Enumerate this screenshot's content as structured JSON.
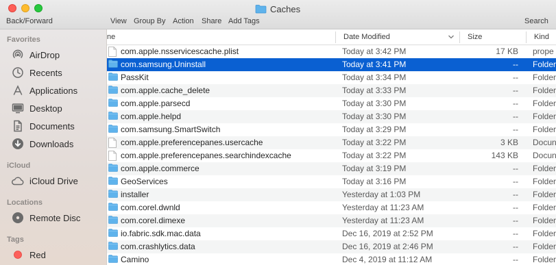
{
  "window": {
    "title": "Caches",
    "traffic": [
      "close",
      "minimize",
      "zoom"
    ]
  },
  "toolbar": {
    "back_forward": "Back/Forward",
    "view": "View",
    "group_by": "Group By",
    "action": "Action",
    "share": "Share",
    "add_tags": "Add Tags",
    "search": "Search"
  },
  "sidebar": {
    "favorites_label": "Favorites",
    "favorites": [
      {
        "label": "AirDrop",
        "icon": "airdrop-icon"
      },
      {
        "label": "Recents",
        "icon": "clock-icon"
      },
      {
        "label": "Applications",
        "icon": "applications-icon"
      },
      {
        "label": "Desktop",
        "icon": "desktop-icon"
      },
      {
        "label": "Documents",
        "icon": "document-icon"
      },
      {
        "label": "Downloads",
        "icon": "download-icon"
      }
    ],
    "icloud_label": "iCloud",
    "icloud": [
      {
        "label": "iCloud Drive",
        "icon": "cloud-icon"
      }
    ],
    "locations_label": "Locations",
    "locations": [
      {
        "label": "Remote Disc",
        "icon": "disc-icon"
      }
    ],
    "tags_label": "Tags",
    "tags": [
      {
        "label": "Red",
        "color": "#fc605b"
      }
    ]
  },
  "columns": {
    "name": "ne",
    "date": "Date Modified",
    "size": "Size",
    "kind": "Kind"
  },
  "colors": {
    "selection": "#0a60d2",
    "folder": "#5fb3ec"
  },
  "files": [
    {
      "name": "com.apple.nsservicescache.plist",
      "date": "Today at 3:42 PM",
      "size": "17 KB",
      "kind": "prope",
      "type": "file"
    },
    {
      "name": "com.samsung.Uninstall",
      "date": "Today at 3:41 PM",
      "size": "--",
      "kind": "Folder",
      "type": "folder",
      "selected": true
    },
    {
      "name": "PassKit",
      "date": "Today at 3:34 PM",
      "size": "--",
      "kind": "Folder",
      "type": "folder"
    },
    {
      "name": "com.apple.cache_delete",
      "date": "Today at 3:33 PM",
      "size": "--",
      "kind": "Folder",
      "type": "folder"
    },
    {
      "name": "com.apple.parsecd",
      "date": "Today at 3:30 PM",
      "size": "--",
      "kind": "Folder",
      "type": "folder"
    },
    {
      "name": "com.apple.helpd",
      "date": "Today at 3:30 PM",
      "size": "--",
      "kind": "Folder",
      "type": "folder"
    },
    {
      "name": "com.samsung.SmartSwitch",
      "date": "Today at 3:29 PM",
      "size": "--",
      "kind": "Folder",
      "type": "folder"
    },
    {
      "name": "com.apple.preferencepanes.usercache",
      "date": "Today at 3:22 PM",
      "size": "3 KB",
      "kind": "Docun",
      "type": "file"
    },
    {
      "name": "com.apple.preferencepanes.searchindexcache",
      "date": "Today at 3:22 PM",
      "size": "143 KB",
      "kind": "Docun",
      "type": "file"
    },
    {
      "name": "com.apple.commerce",
      "date": "Today at 3:19 PM",
      "size": "--",
      "kind": "Folder",
      "type": "folder"
    },
    {
      "name": "GeoServices",
      "date": "Today at 3:16 PM",
      "size": "--",
      "kind": "Folder",
      "type": "folder"
    },
    {
      "name": "installer",
      "date": "Yesterday at 1:03 PM",
      "size": "--",
      "kind": "Folder",
      "type": "folder"
    },
    {
      "name": "com.corel.dwnld",
      "date": "Yesterday at 11:23 AM",
      "size": "--",
      "kind": "Folder",
      "type": "folder"
    },
    {
      "name": "com.corel.dimexe",
      "date": "Yesterday at 11:23 AM",
      "size": "--",
      "kind": "Folder",
      "type": "folder"
    },
    {
      "name": "io.fabric.sdk.mac.data",
      "date": "Dec 16, 2019 at 2:52 PM",
      "size": "--",
      "kind": "Folder",
      "type": "folder"
    },
    {
      "name": "com.crashlytics.data",
      "date": "Dec 16, 2019 at 2:46 PM",
      "size": "--",
      "kind": "Folder",
      "type": "folder"
    },
    {
      "name": "Camino",
      "date": "Dec 4, 2019 at 11:12 AM",
      "size": "--",
      "kind": "Folder",
      "type": "folder"
    }
  ]
}
